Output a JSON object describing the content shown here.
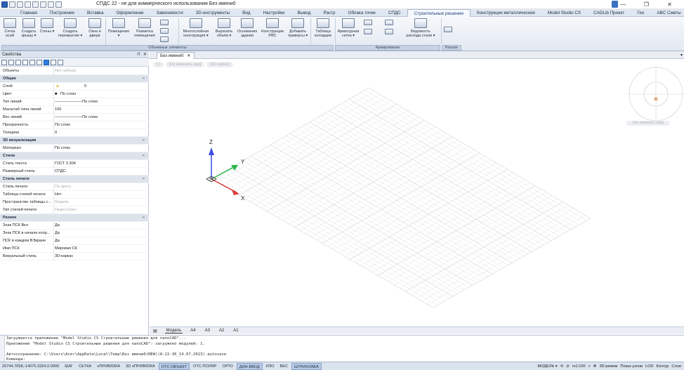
{
  "window": {
    "title": "СПДС 22 - не для коммерческого использования Без имени0"
  },
  "menu_tabs": [
    "Главная",
    "Построение",
    "Вставка",
    "Оформление",
    "Зависимости",
    "3D-инструменты",
    "Вид",
    "Настройки",
    "Вывод",
    "Растр",
    "Облака точек",
    "СПДС",
    "Строительные решения",
    "Конструкции металлические",
    "Model Studio CS",
    "CADLib Проект",
    "Гео",
    "ABC Сметы"
  ],
  "active_tab": "Строительные решения",
  "ribbon": {
    "buttons": [
      {
        "label": "Сетка осей"
      },
      {
        "label": "Создать крышу ▾"
      },
      {
        "label": "Стены ▾"
      },
      {
        "label": "Создать перекрытие ▾"
      },
      {
        "label": "Окна и двери"
      },
      {
        "label": "Помещение ▾"
      },
      {
        "label": "Разметка помещения"
      },
      {
        "label": "Многослойная конструкция ▾"
      },
      {
        "label": "Вырезать объём ▾"
      },
      {
        "label": "Основания здания"
      },
      {
        "label": "Конструкции РВС"
      },
      {
        "label": "Добавить траверсы ▾"
      },
      {
        "label": "Таблица колодцев"
      },
      {
        "label": "Арматурная сетка ▾"
      },
      {
        "label": "Ведомость расхода стали ▾"
      }
    ],
    "groups": [
      "Объемные элементы",
      "Армирование",
      "Разное"
    ]
  },
  "properties_panel": {
    "title": "Свойства",
    "rows": [
      {
        "k": "Объекты",
        "v": "Нет набора",
        "dis": true
      },
      {
        "k": "Общие",
        "sec": true
      },
      {
        "k": "Слой",
        "v": "0"
      },
      {
        "k": "Цвет",
        "v": "По слою"
      },
      {
        "k": "Тип линий",
        "v": "———————По слою"
      },
      {
        "k": "Масштаб типа линий",
        "v": "100"
      },
      {
        "k": "Вес линий",
        "v": "———————По слою"
      },
      {
        "k": "Прозрачность",
        "v": "По слою"
      },
      {
        "k": "Толщина",
        "v": "0"
      },
      {
        "k": "3D визуализация",
        "sec": true
      },
      {
        "k": "Материал",
        "v": "По слою"
      },
      {
        "k": "Стили",
        "sec": true
      },
      {
        "k": "Стиль текста",
        "v": "ГОСТ 2.304"
      },
      {
        "k": "Размерный стиль",
        "v": "СПДС"
      },
      {
        "k": "Стиль печати",
        "sec": true
      },
      {
        "k": "Стиль печати",
        "v": "По цвету",
        "dis": true
      },
      {
        "k": "Таблица стилей печати",
        "v": "Нет"
      },
      {
        "k": "Пространство таблицы с...",
        "v": "Модель",
        "dis": true
      },
      {
        "k": "Тип стилей печати",
        "v": "Недоступен",
        "dis": true
      },
      {
        "k": "Разное",
        "sec": true
      },
      {
        "k": "Знак ПСК Вкл",
        "v": "Да"
      },
      {
        "k": "Знак ПСК в начале коор...",
        "v": "Да"
      },
      {
        "k": "ПСК в каждом ВЭкране",
        "v": "Да"
      },
      {
        "k": "Имя ПСК",
        "v": "Мировая СК"
      },
      {
        "k": "Визуальный стиль",
        "v": "3D-каркас"
      }
    ]
  },
  "document_tab": "Без имени0",
  "viewport": {
    "pills": [
      "[-]",
      "[Не изменить вид]",
      "[3D-каркас]"
    ],
    "viewcube_label": "[Не изменить вид]",
    "axes": {
      "x": "X",
      "y": "Y",
      "z": "Z"
    }
  },
  "layout_tabs": [
    "Модель",
    "A4",
    "A3",
    "A2",
    "A1"
  ],
  "command_lines": [
    "Загружается приложение \"Model Studio CS Строительные решения для nanoCAD\"...",
    "Приложение \"Model Studio CS Строительные решения для nanoCAD\": загружено модулей: 1.",
    "",
    "Автосохранение: C:\\Users\\Acer\\AppData\\Local\\Temp\\Без имени0(NEW)(8-22-36_14.07.2023).autosave",
    "Команда:"
  ],
  "status": {
    "coords": "26744.7058,-14076.3324,0.0000",
    "toggles": [
      "ШАГ",
      "СЕТКА",
      "оПРИВЯЗКА",
      "3D оПРИВЯЗКА",
      "ОТС-ОБЪЕКТ",
      "ОТС-ПОЛЯР",
      "ОРТО",
      "ДИН-ВВОД",
      "ИЗО",
      "ВЕС",
      "ШТРИХОВКА"
    ],
    "model": "МОДЕЛЬ ▾",
    "scale": "m1:100",
    "mode3d": "3D-режим",
    "show_nodes": "Показ узлов",
    "lod": "LOD",
    "contour": "Контур",
    "layers": "Слои"
  }
}
